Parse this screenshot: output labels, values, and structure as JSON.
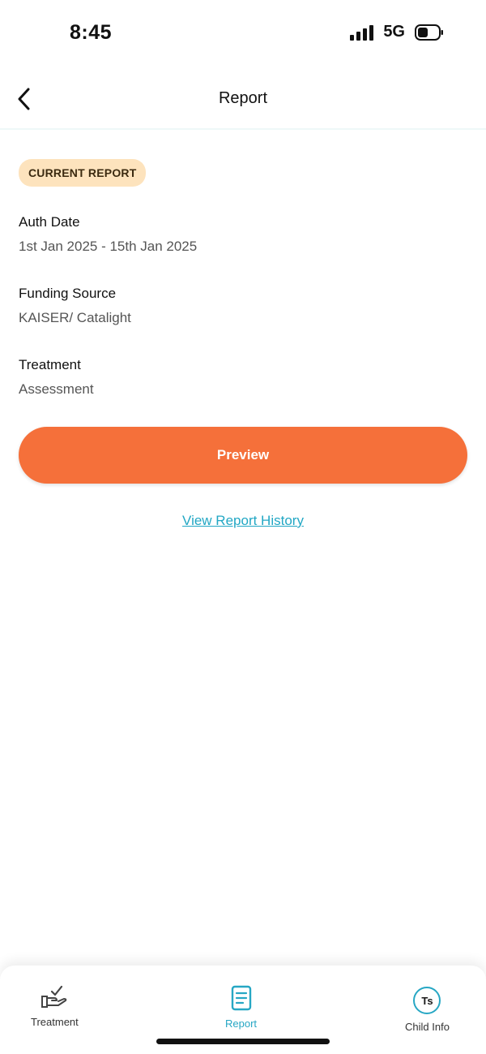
{
  "status_bar": {
    "time": "8:45",
    "network": "5G",
    "signal_icon": "signal-bars-icon",
    "battery_icon": "battery-icon"
  },
  "header": {
    "title": "Report",
    "back_icon": "chevron-left-icon"
  },
  "report": {
    "badge": "CURRENT REPORT",
    "fields": [
      {
        "label": "Auth Date",
        "value": "1st Jan 2025 - 15th Jan 2025"
      },
      {
        "label": "Funding Source",
        "value": "KAISER/ Catalight"
      },
      {
        "label": "Treatment",
        "value": "Assessment"
      }
    ],
    "preview_label": "Preview",
    "history_link": "View Report History"
  },
  "bottom_nav": {
    "items": [
      {
        "label": "Treatment",
        "icon": "hand-check-icon",
        "active": false
      },
      {
        "label": "Report",
        "icon": "document-icon",
        "active": true
      },
      {
        "label": "Child Info",
        "icon": "avatar-initials",
        "initials": "Ts",
        "active": false
      }
    ]
  },
  "colors": {
    "accent_orange": "#f5703a",
    "badge_bg": "#fde3bd",
    "link_teal": "#22a7c4"
  }
}
